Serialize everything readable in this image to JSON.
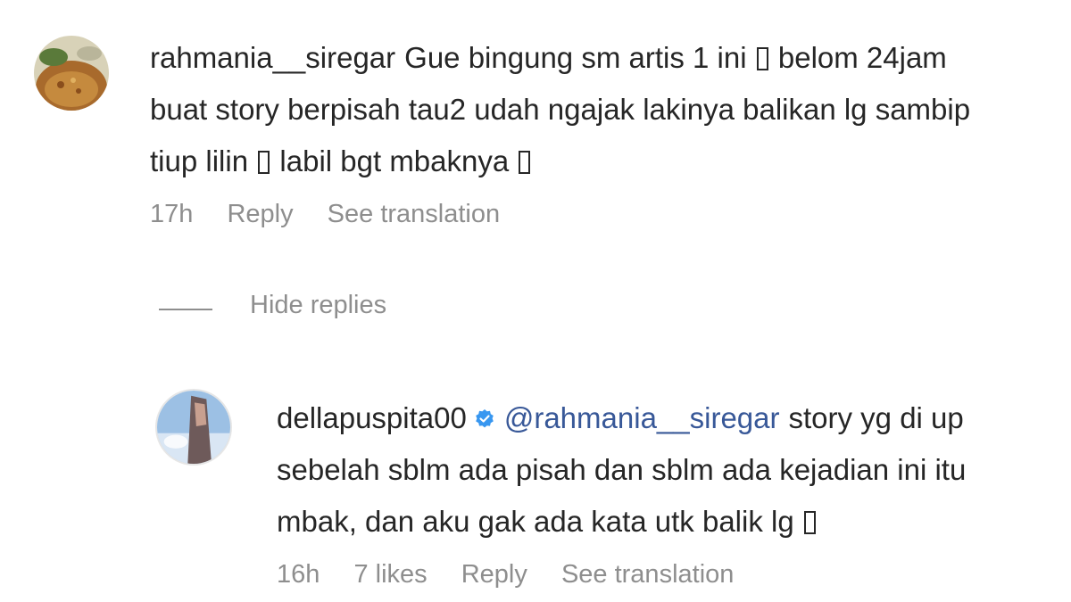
{
  "comment": {
    "username": "rahmania__siregar",
    "lines": [
      [
        "Gue bingung sm artis 1 ini ",
        " belom 24jam"
      ],
      [
        "buat story berpisah tau2 udah ngajak lakinya balikan lg sambip"
      ],
      [
        "tiup lilin ",
        " labil bgt mbaknya ",
        ""
      ]
    ],
    "time": "17h",
    "reply_label": "Reply",
    "translate_label": "See translation"
  },
  "hide_replies_label": "Hide replies",
  "reply": {
    "username": "dellapuspita00",
    "verified": true,
    "mention": "@rahmania__siregar",
    "lines": [
      [
        "story yg di up"
      ],
      [
        "sebelah sblm ada pisah dan sblm ada kejadian ini itu"
      ],
      [
        "mbak, dan aku gak ada kata utk balik lg ",
        ""
      ]
    ],
    "time": "16h",
    "likes": "7 likes",
    "reply_label": "Reply",
    "translate_label": "See translation"
  },
  "colors": {
    "text": "#262626",
    "meta": "#8e8e8e",
    "mention": "#385898",
    "verified": "#3897f0"
  }
}
